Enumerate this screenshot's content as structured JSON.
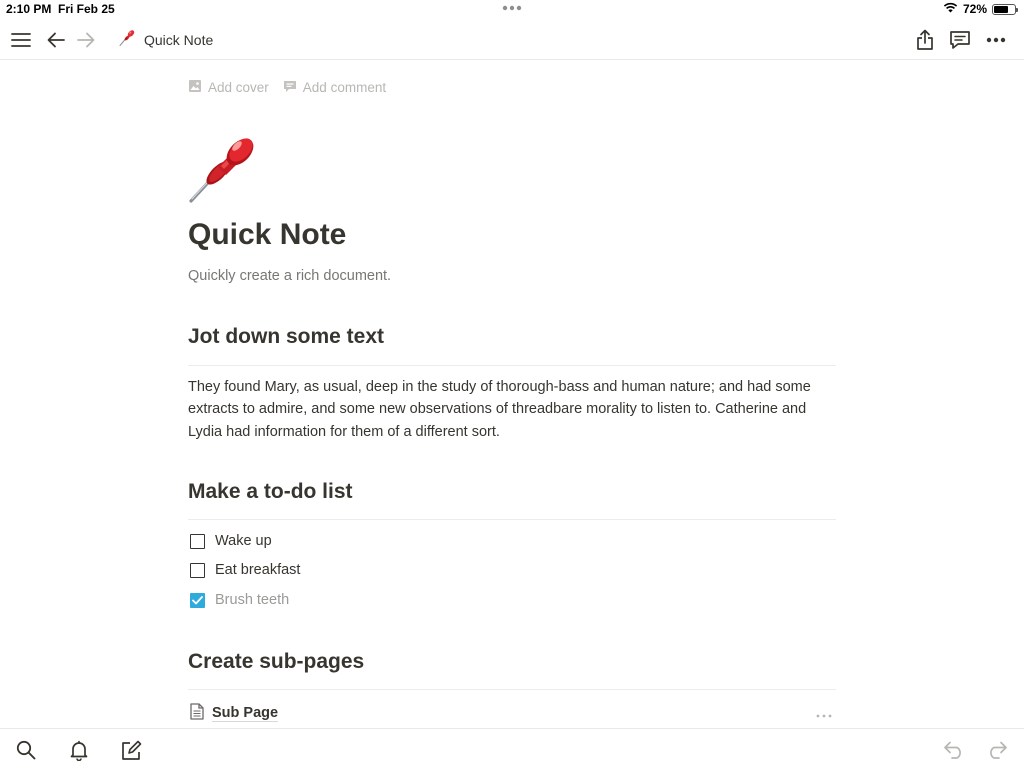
{
  "status_bar": {
    "time": "2:10 PM",
    "date": "Fri Feb 25",
    "battery": "72%",
    "battery_level": 0.72
  },
  "nav": {
    "breadcrumb_title": "Quick Note",
    "breadcrumb_icon": "pushpin-icon"
  },
  "page": {
    "add_cover": "Add cover",
    "add_comment": "Add comment",
    "icon": "pushpin-icon",
    "title": "Quick Note",
    "subtitle": "Quickly create a rich document."
  },
  "sections": {
    "text": {
      "heading": "Jot down some text",
      "paragraph": "They found Mary, as usual, deep in the study of thorough-bass and human nature; and had some extracts to admire, and some new observations of threadbare morality to listen to. Catherine and Lydia had information for them of a different sort."
    },
    "todo": {
      "heading": "Make a to-do list",
      "items": [
        {
          "label": "Wake up",
          "checked": false
        },
        {
          "label": "Eat breakfast",
          "checked": false
        },
        {
          "label": "Brush teeth",
          "checked": true
        }
      ]
    },
    "subpages": {
      "heading": "Create sub-pages",
      "items": [
        {
          "label": "Sub Page"
        }
      ]
    }
  },
  "colors": {
    "text": "#37352f",
    "muted": "#787774",
    "placeholder": "#b8b7b3",
    "checkbox_checked": "#2eaadc",
    "divider": "#ececeb"
  }
}
